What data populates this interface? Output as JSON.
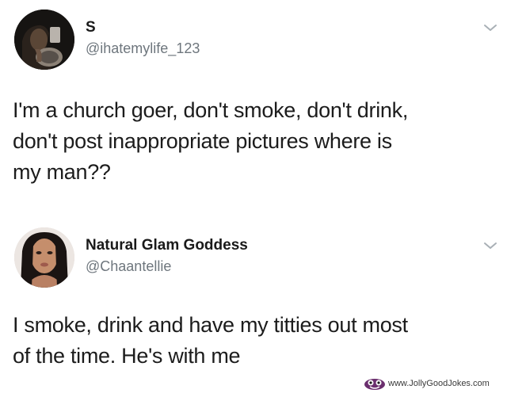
{
  "tweets": [
    {
      "display_name": "S",
      "handle": "@ihatemylife_123",
      "text_lines": [
        "I'm a church goer, don't smoke, don't drink,",
        "don't post inappropriate pictures where is",
        "my man??"
      ]
    },
    {
      "display_name": "Natural Glam Goddess",
      "handle": "@Chaantellie",
      "text_lines": [
        "I smoke, drink and have my titties out most",
        "of the time. He's with me"
      ]
    }
  ],
  "icons": {
    "menu": "chevron-down-icon",
    "watermark_logo": "jollygoodjokes-logo-icon"
  },
  "watermark": {
    "text": "www.JollyGoodJokes.com"
  },
  "colors": {
    "text": "#1c1c1c",
    "handle": "#6e767d",
    "chevron": "#a9b0b6"
  }
}
